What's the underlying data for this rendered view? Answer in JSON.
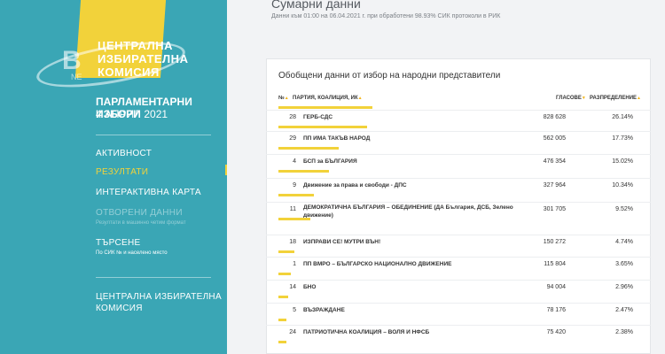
{
  "sidebar": {
    "logo": {
      "lines": [
        "ЦЕНТРАЛНА",
        "ИЗБИРАТЕЛНА",
        "КОМИСИЯ"
      ],
      "watermark": "NE",
      "watermark_b": "B"
    },
    "election_title": "ПАРЛАМЕНТАРНИ ИЗБОРИ",
    "election_date": "4 АПРИЛ 2021",
    "nav": [
      {
        "label": "АКТИВНОСТ",
        "state": "normal"
      },
      {
        "label": "РЕЗУЛТАТИ",
        "state": "active"
      },
      {
        "label": "ИНТЕРАКТИВНА КАРТА",
        "state": "normal"
      },
      {
        "label": "ОТВОРЕНИ ДАННИ",
        "state": "disabled",
        "sub": "Резултати в машинно четим формат"
      },
      {
        "label": "ТЪРСЕНЕ",
        "state": "normal",
        "sub": "По СИК № и населено място"
      }
    ],
    "footer_lines": [
      "ЦЕНТРАЛНА ИЗБИРАТЕЛНА",
      "КОМИСИЯ"
    ]
  },
  "main": {
    "title": "Сумарни данни",
    "subtitle": "Данни към 01:00 на 06.04.2021 г. при обработени 98.93% СИК протоколи в РИК",
    "card_title": "Обобщени данни от избор на народни представители",
    "columns": {
      "num": "№",
      "party": "ПАРТИЯ, КОАЛИЦИЯ, ИК",
      "votes": "ГЛАСОВЕ",
      "share": "РАЗПРЕДЕЛЕНИЕ"
    },
    "rows": [
      {
        "num": "28",
        "name": "ГЕРБ-СДС",
        "votes": "828 628",
        "share": "26.14%",
        "pct": 26.14
      },
      {
        "num": "29",
        "name": "ПП ИМА ТАКЪВ НАРОД",
        "votes": "562 005",
        "share": "17.73%",
        "pct": 17.73
      },
      {
        "num": "4",
        "name": "БСП за БЪЛГАРИЯ",
        "votes": "476 354",
        "share": "15.02%",
        "pct": 15.02
      },
      {
        "num": "9",
        "name": "Движение за права и свободи - ДПС",
        "votes": "327 964",
        "share": "10.34%",
        "pct": 10.34
      },
      {
        "num": "11",
        "name": "ДЕМОКРАТИЧНА БЪЛГАРИЯ – ОБЕДИНЕНИЕ (ДА България, ДСБ, Зелено движение)",
        "votes": "301 705",
        "share": "9.52%",
        "pct": 9.52
      },
      {
        "num": "18",
        "name": "ИЗПРАВИ СЕ! МУТРИ ВЪН!",
        "votes": "150 272",
        "share": "4.74%",
        "pct": 4.74
      },
      {
        "num": "1",
        "name": "ПП ВМРО – БЪЛГАРСКО НАЦИОНАЛНО ДВИЖЕНИЕ",
        "votes": "115 804",
        "share": "3.65%",
        "pct": 3.65
      },
      {
        "num": "14",
        "name": "БНО",
        "votes": "94 004",
        "share": "2.96%",
        "pct": 2.96
      },
      {
        "num": "5",
        "name": "ВЪЗРАЖДАНЕ",
        "votes": "78 176",
        "share": "2.47%",
        "pct": 2.47
      },
      {
        "num": "24",
        "name": "ПАТРИОТИЧНА КОАЛИЦИЯ – ВОЛЯ И НФСБ",
        "votes": "75 420",
        "share": "2.38%",
        "pct": 2.38
      }
    ]
  },
  "colors": {
    "sidebar": "#3aa6b5",
    "accent": "#f2d23a"
  }
}
